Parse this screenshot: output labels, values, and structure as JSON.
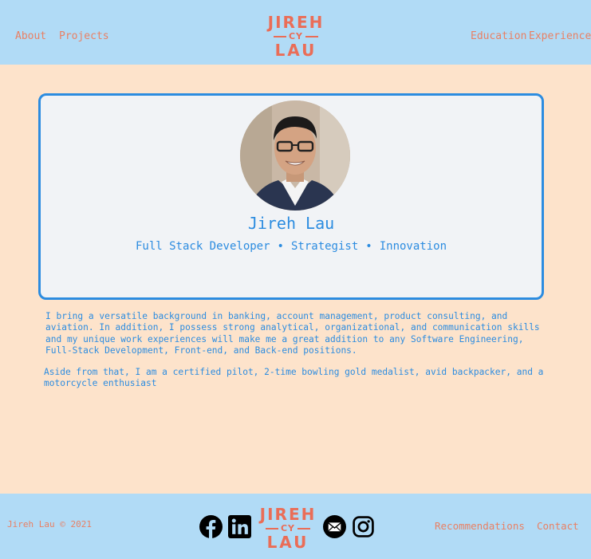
{
  "header": {
    "nav_left": [
      "About",
      "Projects"
    ],
    "nav_right": [
      "Education",
      "Experience"
    ],
    "logo": {
      "line1": "JIREH",
      "line2": "CY",
      "line3": "LAU"
    }
  },
  "profile": {
    "name": "Jireh Lau",
    "roles": [
      "Full Stack Developer",
      "Strategist",
      "Innovation"
    ],
    "separator": "•"
  },
  "bio": {
    "paragraph1_lines": [
      "I bring a versatile background in banking, account management, product consulting, and",
      "aviation. In addition, I possess strong analytical, organizational, and communication skills",
      "and my unique work experiences will make me a great addition to any Software Engineering,",
      "Full-Stack Development, Front-end, and Back-end positions."
    ],
    "paragraph2_lines": [
      "Aside from that, I am a certified pilot, 2-time bowling gold medalist, avid backpacker, and a",
      "motorcycle enthusiast"
    ]
  },
  "footer": {
    "copyright": "Jireh Lau © 2021",
    "links": [
      "Recommendations",
      "Contact"
    ],
    "social_icons": [
      "facebook-icon",
      "linkedin-icon",
      "email-icon",
      "instagram-icon"
    ]
  },
  "colors": {
    "page_bg": "#fde3cb",
    "bar_bg": "#b1dbf6",
    "accent_orange": "#e98064",
    "accent_blue": "#2c8ce0",
    "card_bg": "#f1f3f6"
  }
}
